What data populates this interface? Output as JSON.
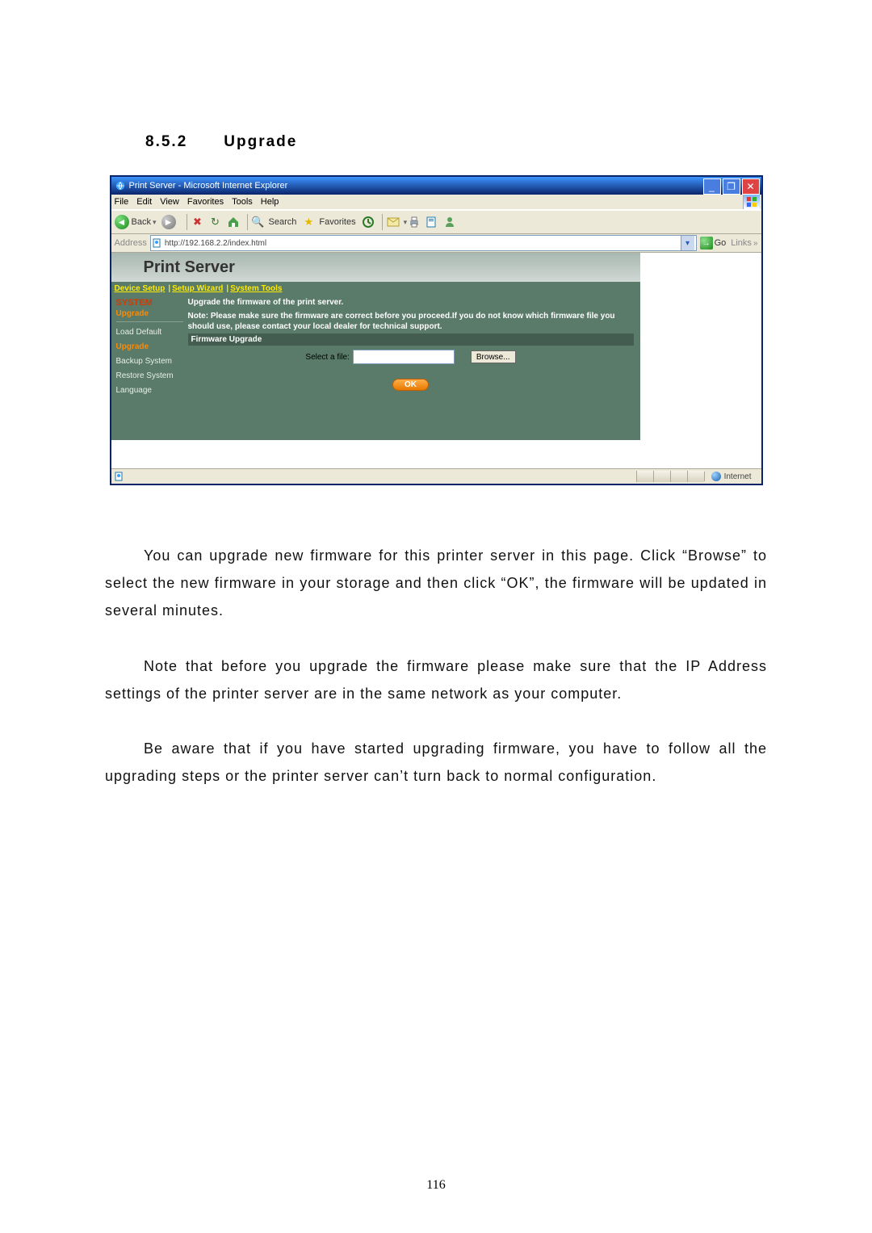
{
  "doc": {
    "section_no": "8.5.2",
    "section_title": "Upgrade",
    "para1": "You can upgrade new firmware for this printer server in this page. Click “Browse” to select the new firmware in your storage and then click “OK”, the firmware will be updated in several minutes.",
    "para2": "Note that before you upgrade the firmware please make sure that the IP Address settings of the printer server are in the same network as your computer.",
    "para3": "Be aware that if you have started upgrading firmware, you have to follow all the upgrading steps or the printer server can’t turn back to normal configuration.",
    "pageno": "116"
  },
  "ie": {
    "title": "Print Server - Microsoft Internet Explorer",
    "menu": [
      "File",
      "Edit",
      "View",
      "Favorites",
      "Tools",
      "Help"
    ],
    "toolbar": {
      "back": "Back",
      "search": "Search",
      "favorites": "Favorites"
    },
    "address_label": "Address",
    "url": "http://192.168.2.2/index.html",
    "go": "Go",
    "links": "Links",
    "status_zone": "Internet"
  },
  "app": {
    "banner": "Print Server",
    "topnav": [
      "Device Setup",
      "Setup Wizard",
      "System Tools"
    ],
    "sidebar_header": "SYSTEM",
    "sidebar_sub": "Upgrade",
    "sidebar": [
      "Load Default",
      "Upgrade",
      "Backup System",
      "Restore System",
      "Language"
    ],
    "main_title": "Upgrade the firmware of the print server.",
    "main_note": "Note: Please make sure the firmware are correct before you proceed.If you do not know which firmware file you should use, please contact your local dealer for technical support.",
    "fw_header": "Firmware Upgrade",
    "file_label": "Select a file:",
    "browse": "Browse...",
    "ok": "OK"
  }
}
